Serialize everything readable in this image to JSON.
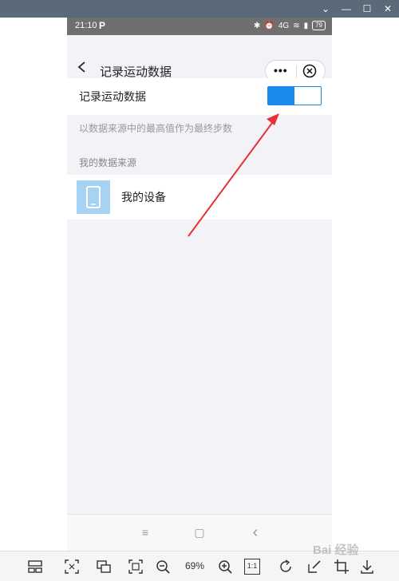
{
  "window": {
    "controls": [
      "⌄",
      "—",
      "☐",
      "✕"
    ]
  },
  "status_bar": {
    "time": "21:10",
    "app_badge": "P",
    "signal_text": "4G",
    "battery": "79"
  },
  "nav": {
    "title": "记录运动数据",
    "more_label": "•••"
  },
  "toggle_card": {
    "label": "记录运动数据",
    "enabled": true,
    "fill_fraction": 0.5,
    "accent": "#1a8bea"
  },
  "hint": "以数据来源中的最高值作为最终步数",
  "sources": {
    "section_label": "我的数据来源",
    "items": [
      {
        "label": "我的设备",
        "icon": "phone-icon"
      }
    ]
  },
  "system_nav": {
    "menu": "≡",
    "home": "▢",
    "back": "‹"
  },
  "viewer_toolbar": {
    "zoom": "69%",
    "one_to_one": "1:1"
  },
  "watermark": "Bai 经验",
  "annotation": {
    "color": "#e63232"
  }
}
